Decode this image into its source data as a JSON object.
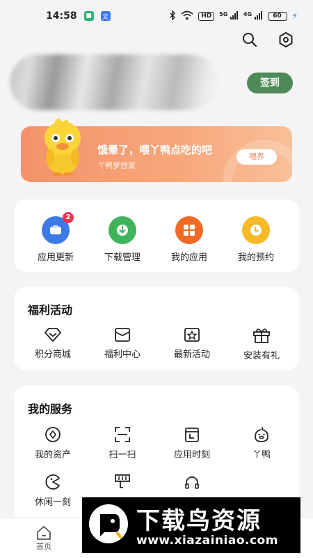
{
  "status_bar": {
    "time": "14:58",
    "hd": "HD",
    "net_a": "5G",
    "net_b": "4G",
    "battery": "60"
  },
  "header": {
    "signin_label": "签到"
  },
  "banner": {
    "title": "饿晕了，喂丫鸭点吃的吧",
    "subtitle": "丫鸭梦想家",
    "button_label": "喂养"
  },
  "quick_actions": [
    {
      "label": "应用更新",
      "badge": "2",
      "color": "#3d7ae6",
      "icon": "app-update-icon"
    },
    {
      "label": "下载管理",
      "color": "#3fb35a",
      "icon": "download-icon"
    },
    {
      "label": "我的应用",
      "color": "#f06a26",
      "icon": "apps-grid-icon"
    },
    {
      "label": "我的预约",
      "color": "#f7b928",
      "icon": "clock-icon"
    }
  ],
  "welfare": {
    "title": "福利活动",
    "items": [
      {
        "label": "积分商城",
        "icon": "diamond-icon"
      },
      {
        "label": "福利中心",
        "icon": "envelope-icon"
      },
      {
        "label": "最新活动",
        "icon": "star-frame-icon"
      },
      {
        "label": "安装有礼",
        "icon": "gift-icon"
      }
    ]
  },
  "services": {
    "title": "我的服务",
    "items": [
      {
        "label": "我的资产",
        "icon": "asset-icon"
      },
      {
        "label": "扫一扫",
        "icon": "scan-icon"
      },
      {
        "label": "应用时刻",
        "icon": "calendar-icon"
      },
      {
        "label": "丫鸭",
        "icon": "duck-icon"
      },
      {
        "label": "休闲一刻",
        "icon": "pacman-icon"
      },
      {
        "label": "",
        "icon": "sign-icon"
      },
      {
        "label": "",
        "icon": "headphones-icon"
      }
    ]
  },
  "tabbar": {
    "home_label": "首页"
  },
  "watermark": {
    "title": "下载鸟资源",
    "url": "www.xiazainiao.com"
  }
}
